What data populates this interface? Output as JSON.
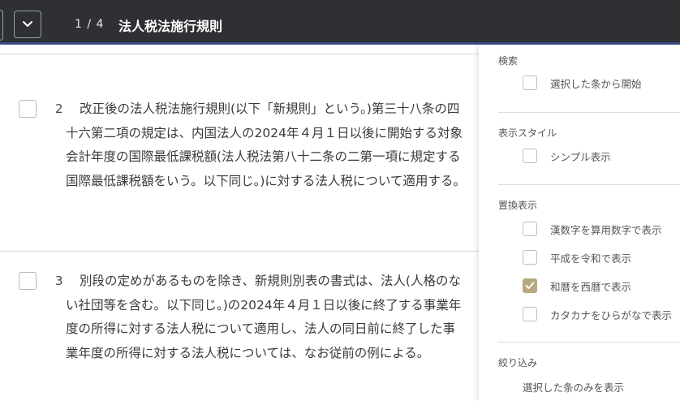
{
  "header": {
    "page_indicator": "1 / 4",
    "title": "法人税法施行規則"
  },
  "paragraphs": [
    {
      "number": "2",
      "lines": [
        "改正後の法人税法施行規則(以下「新規則」という。)第三十八条の四",
        "十六第二項の規定は、内国法人の2024年４月１日以後に開始する対象",
        "会計年度の国際最低課税額(法人税法第八十二条の二第一項に規定する",
        "国際最低課税額をいう。以下同じ。)に対する法人税について適用する。"
      ]
    },
    {
      "number": "3",
      "lines": [
        "別段の定めがあるものを除き、新規則別表の書式は、法人(人格のな",
        "い社団等を含む。以下同じ。)の2024年４月１日以後に終了する事業年",
        "度の所得に対する法人税について適用し、法人の同日前に終了した事",
        "業年度の所得に対する法人税については、なお従前の例による。"
      ]
    }
  ],
  "panel": {
    "search": {
      "label": "検索",
      "options": [
        {
          "label": "選択した条から開始",
          "checked": false
        }
      ]
    },
    "display_style": {
      "label": "表示スタイル",
      "options": [
        {
          "label": "シンプル表示",
          "checked": false
        }
      ]
    },
    "replace": {
      "label": "置換表示",
      "options": [
        {
          "label": "漢数字を算用数字で表示",
          "checked": false
        },
        {
          "label": "平成を令和で表示",
          "checked": false
        },
        {
          "label": "和暦を西暦で表示",
          "checked": true
        },
        {
          "label": "カタカナをひらがなで表示",
          "checked": false
        }
      ]
    },
    "filter": {
      "label": "絞り込み",
      "option": "選択した条のみを表示"
    }
  },
  "colors": {
    "header_bg": "#2e3033",
    "header_accent": "#3d4a8a",
    "checked": "#b8a97e"
  }
}
